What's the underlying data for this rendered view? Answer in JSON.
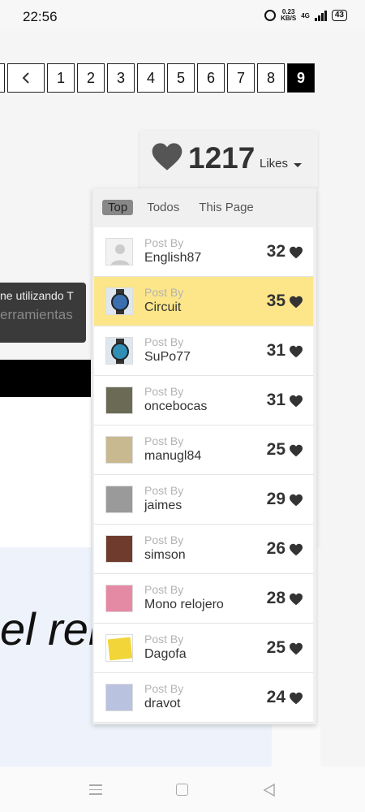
{
  "status": {
    "time": "22:56",
    "speed_value": "0.23",
    "speed_unit": "KB/S",
    "network": "4G",
    "battery": "43"
  },
  "pagination": {
    "pages": [
      "1",
      "2",
      "3",
      "4",
      "5",
      "6",
      "7",
      "8",
      "9"
    ],
    "active": "9"
  },
  "background": {
    "tooltip_line1": "ne utilizando T",
    "tooltip_line2": "erramientas",
    "big_text": "el relo"
  },
  "likes": {
    "count": "1217",
    "label": "Likes",
    "tabs": [
      "Top",
      "Todos",
      "This Page"
    ],
    "active_tab": "Top",
    "post_by_label": "Post By",
    "entries": [
      {
        "user": "English87",
        "score": "32",
        "avatar": "placeholder-avatar",
        "color": "#e6e6e6"
      },
      {
        "user": "Circuit",
        "score": "35",
        "avatar": "watch-avatar",
        "color": "#3b6fb0"
      },
      {
        "user": "SuPo77",
        "score": "31",
        "avatar": "watch-avatar",
        "color": "#2f8fb5"
      },
      {
        "user": "oncebocas",
        "score": "31",
        "avatar": "building-avatar",
        "color": "#6b6a55"
      },
      {
        "user": "manugl84",
        "score": "25",
        "avatar": "wave-avatar",
        "color": "#c9b991"
      },
      {
        "user": "jaimes",
        "score": "29",
        "avatar": "photo-avatar",
        "color": "#9a9a9a"
      },
      {
        "user": "simson",
        "score": "26",
        "avatar": "portrait-avatar",
        "color": "#6e3b2c"
      },
      {
        "user": "Mono relojero",
        "score": "28",
        "avatar": "cartoon-avatar",
        "color": "#e58aa5"
      },
      {
        "user": "Dagofa",
        "score": "25",
        "avatar": "note-avatar",
        "color": "#f2d538"
      },
      {
        "user": "dravot",
        "score": "24",
        "avatar": "illustration-avatar",
        "color": "#b9c3e0"
      }
    ]
  }
}
